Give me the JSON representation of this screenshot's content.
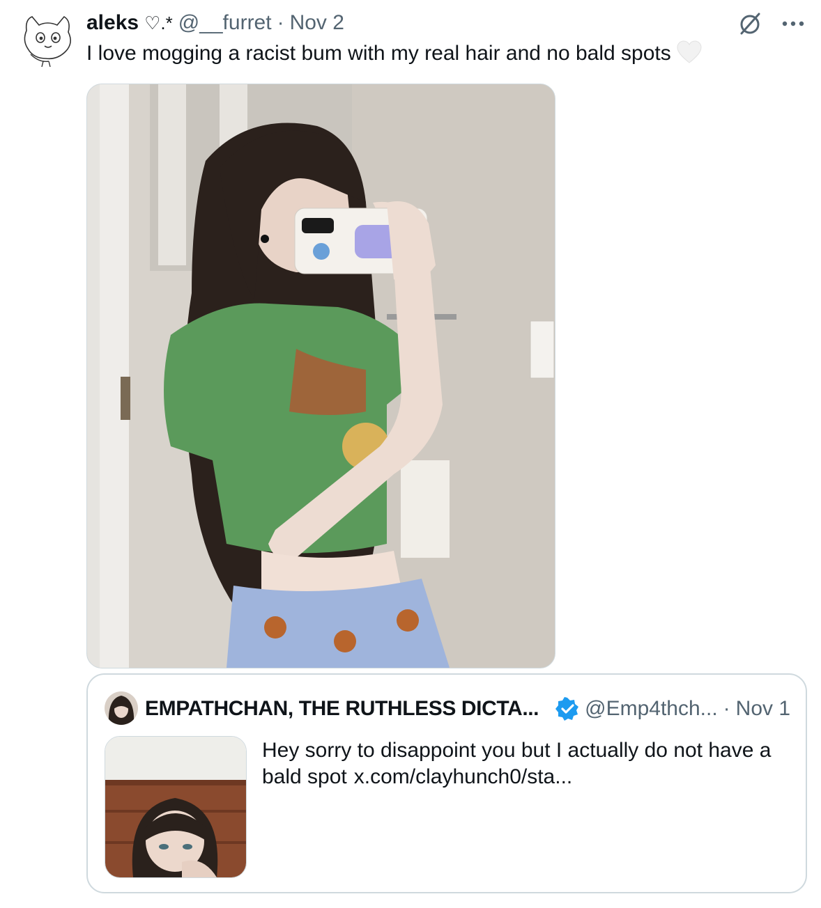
{
  "tweet": {
    "author": {
      "display_name": "aleks",
      "name_decoration": "♡.*",
      "handle": "@__furret",
      "separator": "·",
      "date": "Nov 2"
    },
    "text": "I love mogging a racist bum with my real hair and no bald spots",
    "emoji": "white-heart-icon",
    "actions": [
      "grok-icon",
      "more-icon"
    ]
  },
  "quote": {
    "author": {
      "display_name": "EMPATHCHAN, THE RUTHLESS DICTA...",
      "verified": true,
      "handle": "@Emp4thch...",
      "separator": "·",
      "date": "Nov 1"
    },
    "text_line1": "Hey sorry to disappoint you but I actually do not have a",
    "text_line2": "bald spot",
    "link": "x.com/clayhunch0/sta..."
  },
  "colors": {
    "text": "#0f1419",
    "secondary": "#536471",
    "border": "#cfd9de",
    "verified": "#1d9bf0",
    "shirt": "#5b9a5b"
  }
}
